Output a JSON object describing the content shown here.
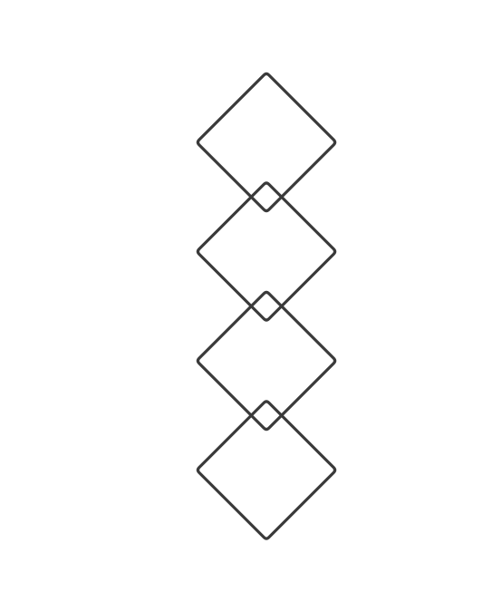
{
  "diagram": {
    "shape": "diamond",
    "count": 4,
    "arrangement": "vertical chain",
    "stroke_color": "#3a3a3a",
    "fill_color": "none",
    "background_color": "#ffffff"
  }
}
